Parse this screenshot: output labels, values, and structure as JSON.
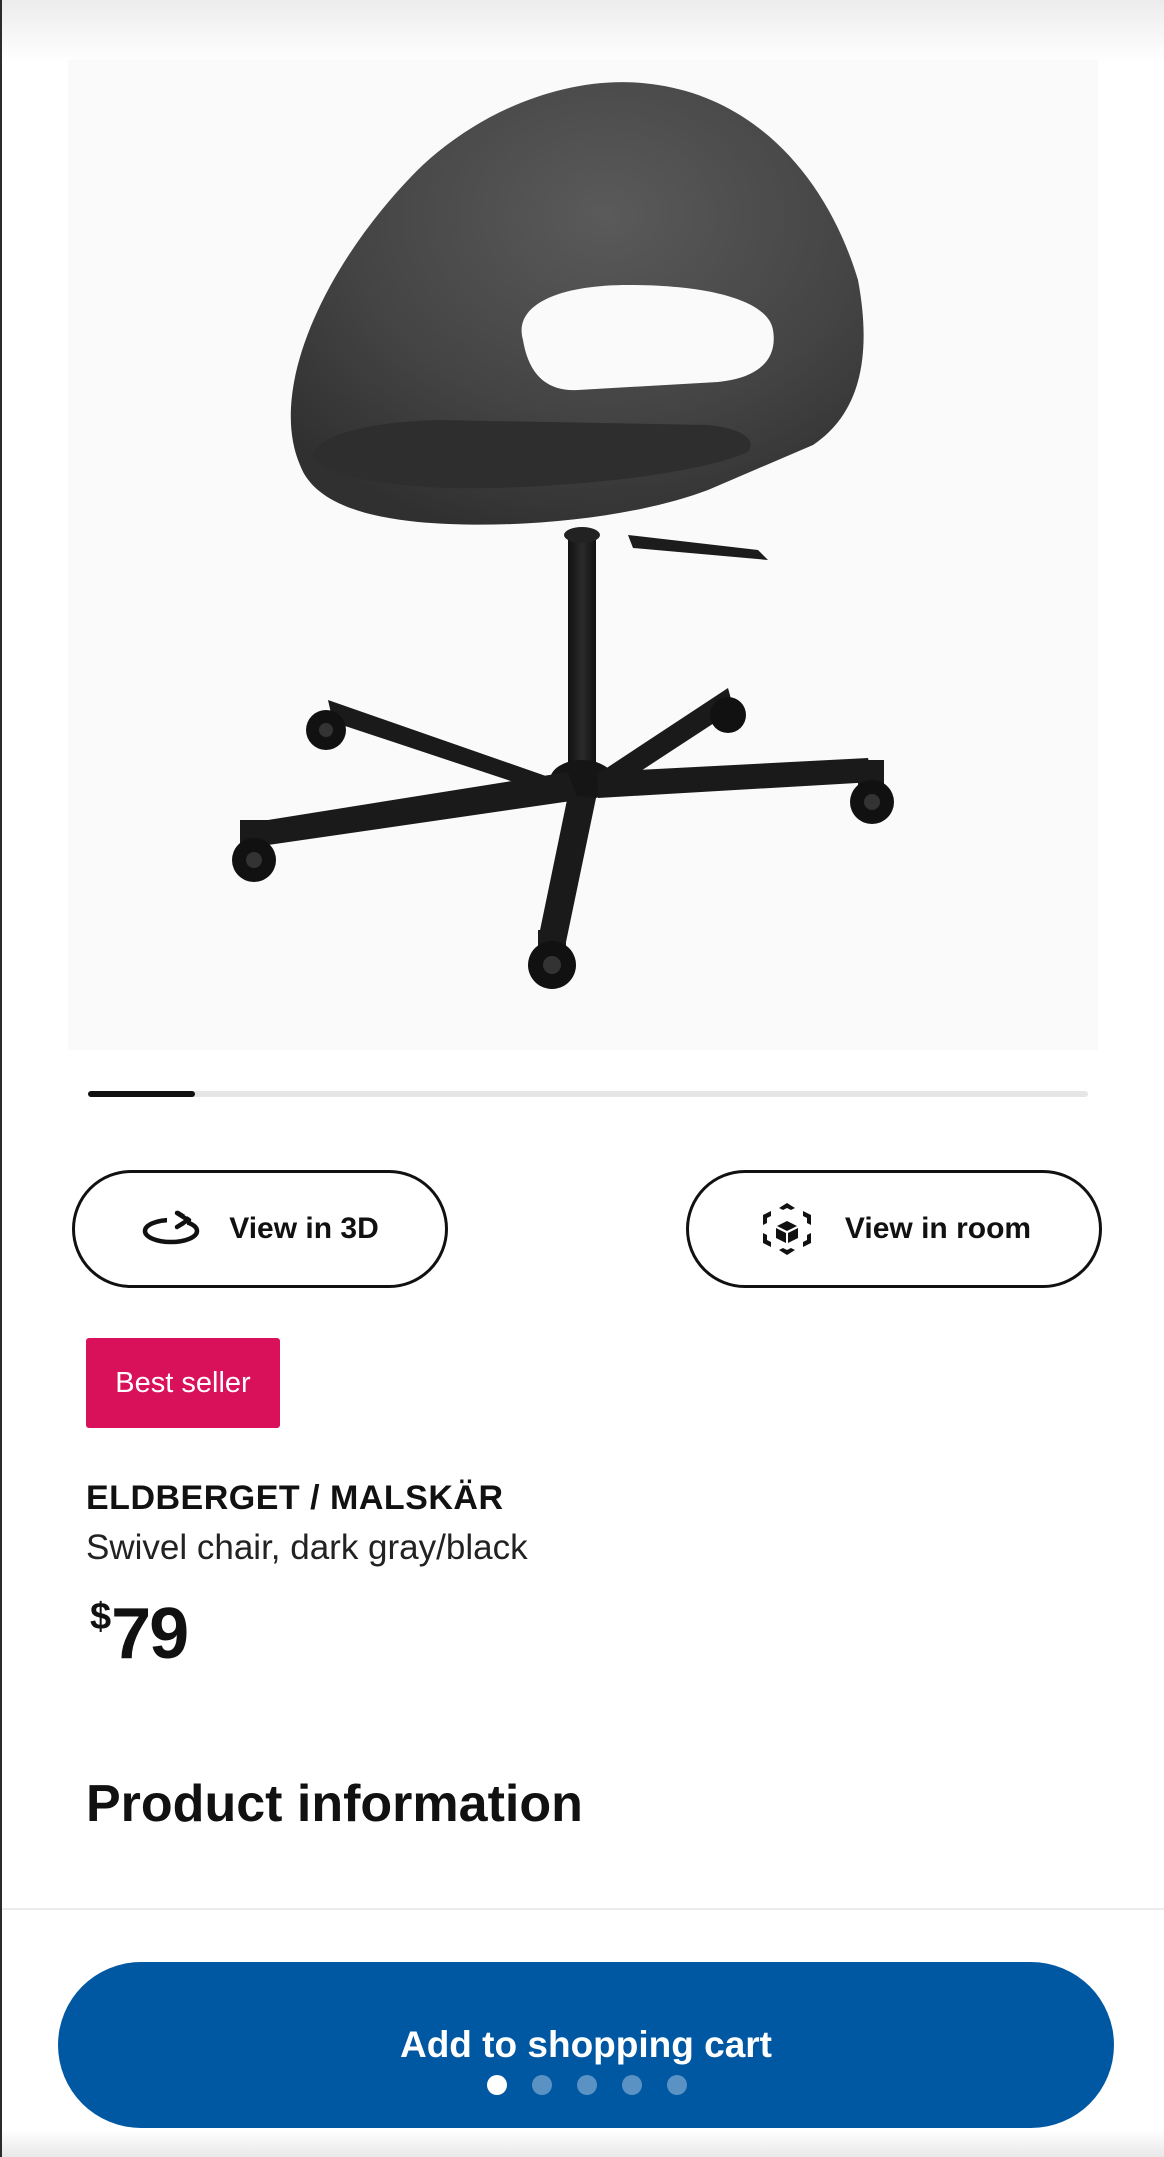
{
  "product_image": {
    "alt": "ELDBERGET / MALSKÄR swivel chair",
    "gallery_position": 0.107
  },
  "actions": {
    "view_3d_label": "View in 3D",
    "view_3d_icon": "rotate-3d-icon",
    "view_room_label": "View in room",
    "view_room_icon": "ar-cube-icon"
  },
  "badge": {
    "label": "Best seller",
    "color": "#d9115a"
  },
  "product": {
    "name": "ELDBERGET / MALSKÄR",
    "description": "Swivel chair, dark gray/black",
    "price_currency": "$",
    "price_amount": "79"
  },
  "section": {
    "title": "Product information"
  },
  "cart": {
    "label": "Add to shopping cart",
    "color": "#0058a3"
  },
  "page_indicator": {
    "count": 5,
    "active_index": 0
  }
}
